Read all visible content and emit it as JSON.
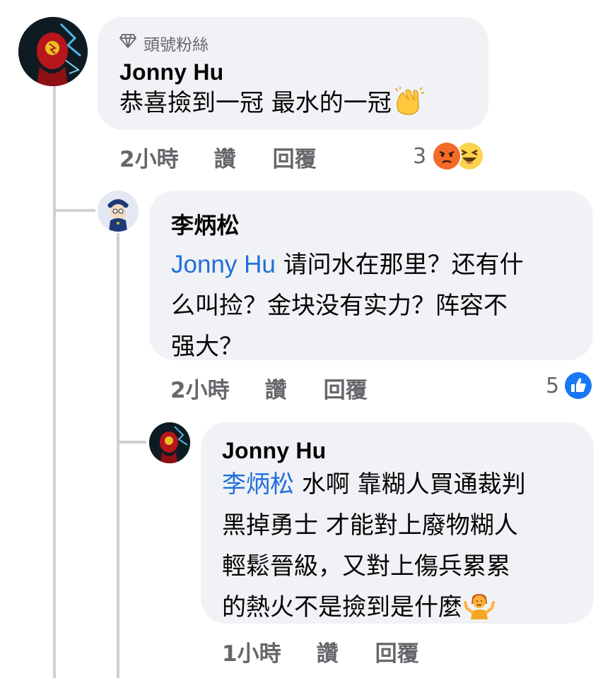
{
  "comments": [
    {
      "badge_icon": "diamond-icon",
      "badge": "頭號粉絲",
      "author": "Jonny Hu",
      "text": "恭喜撿到一冠 最水的一冠",
      "emoji_icon": "clapping-hands-emoji",
      "time": "2小時",
      "like": "讚",
      "reply": "回覆",
      "reaction_count": "3",
      "reactions": [
        "angry-reaction-icon",
        "haha-reaction-icon"
      ]
    },
    {
      "author": "李炳松",
      "mention": "Jonny Hu",
      "text_lines": [
        "请问水在那里？还有什",
        "么叫捡？金块没有实力？阵容不",
        "强大？"
      ],
      "time": "2小時",
      "like": "讚",
      "reply": "回覆",
      "reaction_count": "5",
      "reactions": [
        "like-reaction-icon"
      ]
    },
    {
      "author": "Jonny Hu",
      "mention": "李炳松",
      "text_lines": [
        "水啊 靠糊人買通裁判",
        "黑掉勇士 才能對上廢物糊人",
        "輕鬆晉級，又對上傷兵累累",
        "的熱火不是撿到是什麼"
      ],
      "emoji_icon": "person-shrugging-emoji",
      "time": "1小時",
      "like": "讚",
      "reply": "回覆"
    }
  ],
  "colors": {
    "bubble": "#f0f2f5",
    "meta": "#65676b",
    "mention": "#216fdb",
    "thread": "#ced0d4"
  }
}
